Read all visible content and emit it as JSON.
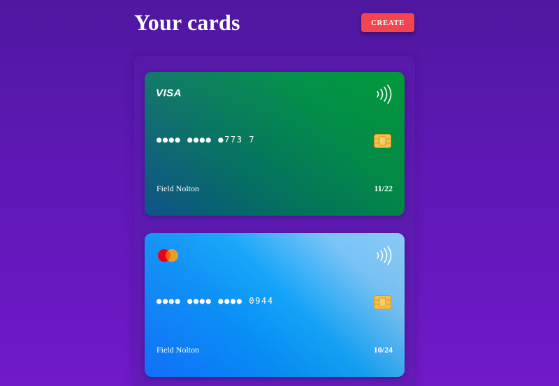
{
  "header": {
    "title": "Your cards",
    "create_label": "CREATE"
  },
  "colors": {
    "create_button": "#f2454f",
    "visa_card_start": "#0c4f86",
    "visa_card_end": "#049a3a",
    "mastercard_card_start": "#0d6df7",
    "mastercard_card_end": "#8ccdf9"
  },
  "cards": [
    {
      "brand": "VISA",
      "brand_icon": "visa-logo",
      "contactless_icon": "contactless-icon",
      "chip_icon": "chip-icon",
      "number": "●●●● ●●●● ●773 7",
      "holder": "Field Nolton",
      "expiry": "11/22"
    },
    {
      "brand": "Mastercard",
      "brand_icon": "mastercard-logo-icon",
      "contactless_icon": "contactless-icon",
      "chip_icon": "chip-icon",
      "number": "●●●● ●●●● ●●●● 0944",
      "holder": "Field Nolton",
      "expiry": "10/24"
    }
  ]
}
